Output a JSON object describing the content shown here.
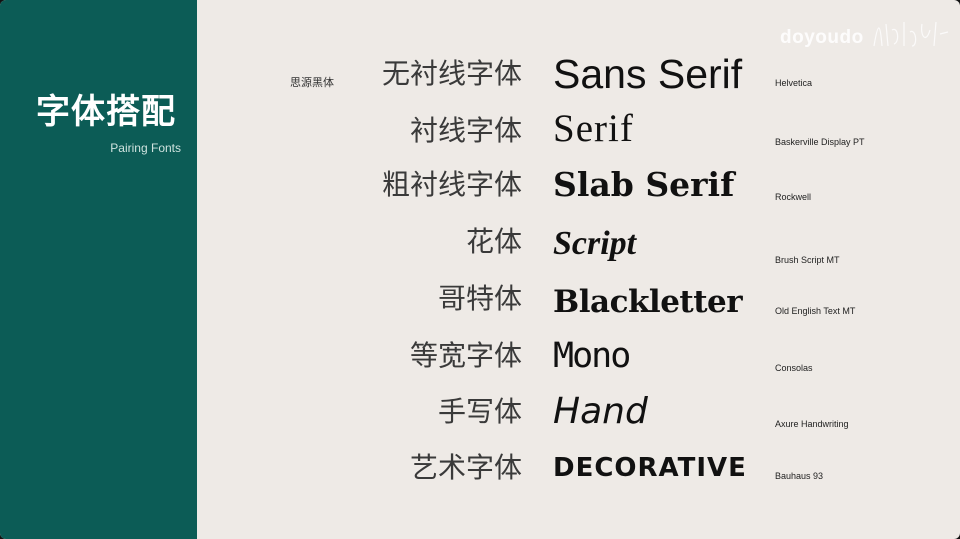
{
  "sidebar": {
    "title": "字体搭配",
    "subtitle": "Pairing Fonts"
  },
  "watermark": "doyoudo",
  "caption": "思源黑体",
  "rows": [
    {
      "category": "无衬线字体",
      "sample": "Sans Serif",
      "font": "Helvetica"
    },
    {
      "category": "衬线字体",
      "sample": "Serif",
      "font": "Baskerville Display PT"
    },
    {
      "category": "粗衬线字体",
      "sample": "Slab Serif",
      "font": "Rockwell"
    },
    {
      "category": "花体",
      "sample": "Script",
      "font": "Brush Script MT"
    },
    {
      "category": "哥特体",
      "sample": "Blackletter",
      "font": "Old English Text MT"
    },
    {
      "category": "等宽字体",
      "sample": "Mono",
      "font": "Consolas"
    },
    {
      "category": "手写体",
      "sample": "Hand",
      "font": "Axure Handwriting"
    },
    {
      "category": "艺术字体",
      "sample": "DECORATIVE",
      "font": "Bauhaus 93"
    }
  ]
}
